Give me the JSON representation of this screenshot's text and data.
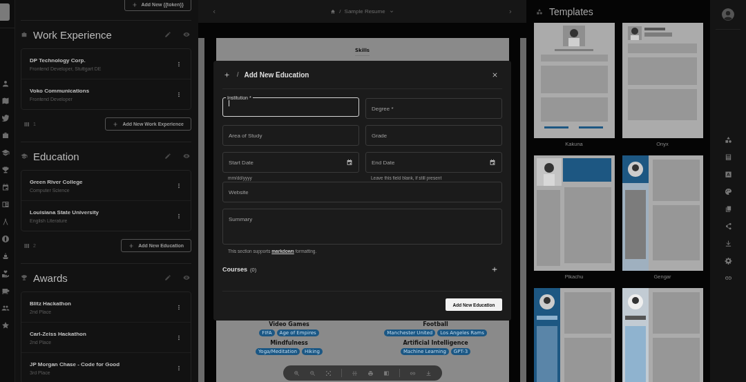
{
  "left_panel": {
    "top_button": "Add New {{token}}",
    "sections": [
      {
        "kind": "work",
        "title": "Work Experience",
        "items": [
          {
            "name": "DP Technology Corp.",
            "detail": "Frontend Developer, Stuttgart DE"
          },
          {
            "name": "Voko Communications",
            "detail": "Frontend Developer"
          }
        ],
        "columns": "1",
        "add_button": "Add New Work Experience"
      },
      {
        "kind": "education",
        "title": "Education",
        "items": [
          {
            "name": "Green River College",
            "detail": "Computer Science"
          },
          {
            "name": "Louisiana State University",
            "detail": "English Literature"
          }
        ],
        "columns": "2",
        "add_button": "Add New Education"
      },
      {
        "kind": "awards",
        "title": "Awards",
        "items": [
          {
            "name": "Blitz Hackathon",
            "detail": "2nd Place"
          },
          {
            "name": "Carl-Zeiss Hackathon",
            "detail": "2nd Place"
          },
          {
            "name": "JP Morgan Chase - Code for Good",
            "detail": "3rd Place"
          }
        ]
      }
    ]
  },
  "header": {
    "separator": "/",
    "title": "Sample Resume"
  },
  "resume": {
    "heading": "Skills",
    "groups": [
      {
        "name": "Video Games",
        "tags": [
          "FIFA",
          "Age of Empires"
        ]
      },
      {
        "name": "Football",
        "tags": [
          "Manchester United",
          "Los Angeles Rams"
        ]
      },
      {
        "name": "Mindfulness",
        "tags": [
          "Yoga/Meditation",
          "Hiking"
        ]
      },
      {
        "name": "Artificial Intelligence",
        "tags": [
          "Machine Learning",
          "GPT-3"
        ]
      }
    ]
  },
  "modal": {
    "separator": "/",
    "title": "Add New Education",
    "rows": [
      [
        {
          "kind": "text",
          "label": "Institution *",
          "focused": true
        },
        {
          "kind": "text",
          "label": "Degree *",
          "focused": false
        }
      ],
      [
        {
          "kind": "text",
          "label": "Area of Study",
          "focused": false
        },
        {
          "kind": "text",
          "label": "Grade",
          "focused": false
        }
      ],
      [
        {
          "kind": "date",
          "label": "Start Date",
          "focused": false,
          "hint": "mm/dd/yyyy"
        },
        {
          "kind": "date",
          "label": "End Date",
          "focused": false,
          "hint": "Leave this field blank, if still present"
        }
      ],
      [
        {
          "kind": "text",
          "label": "Website",
          "focused": false
        }
      ],
      [
        {
          "kind": "textarea",
          "label": "Summary",
          "focused": false
        }
      ]
    ],
    "note": {
      "before": "This section supports",
      "link": "markdown",
      "after": "formatting."
    },
    "courses": {
      "label": "Courses",
      "count": "(0)"
    },
    "submit": "Add New Education"
  },
  "templates": {
    "title": "Templates",
    "items": [
      {
        "name": "Kakuna",
        "kind": "picture"
      },
      {
        "name": "Onyx",
        "kind": "picture"
      },
      {
        "name": "Pikachu",
        "kind": "picture"
      },
      {
        "name": "Gengar",
        "kind": "picture"
      },
      {
        "kind": "picture"
      },
      {
        "kind": "picture"
      }
    ]
  }
}
